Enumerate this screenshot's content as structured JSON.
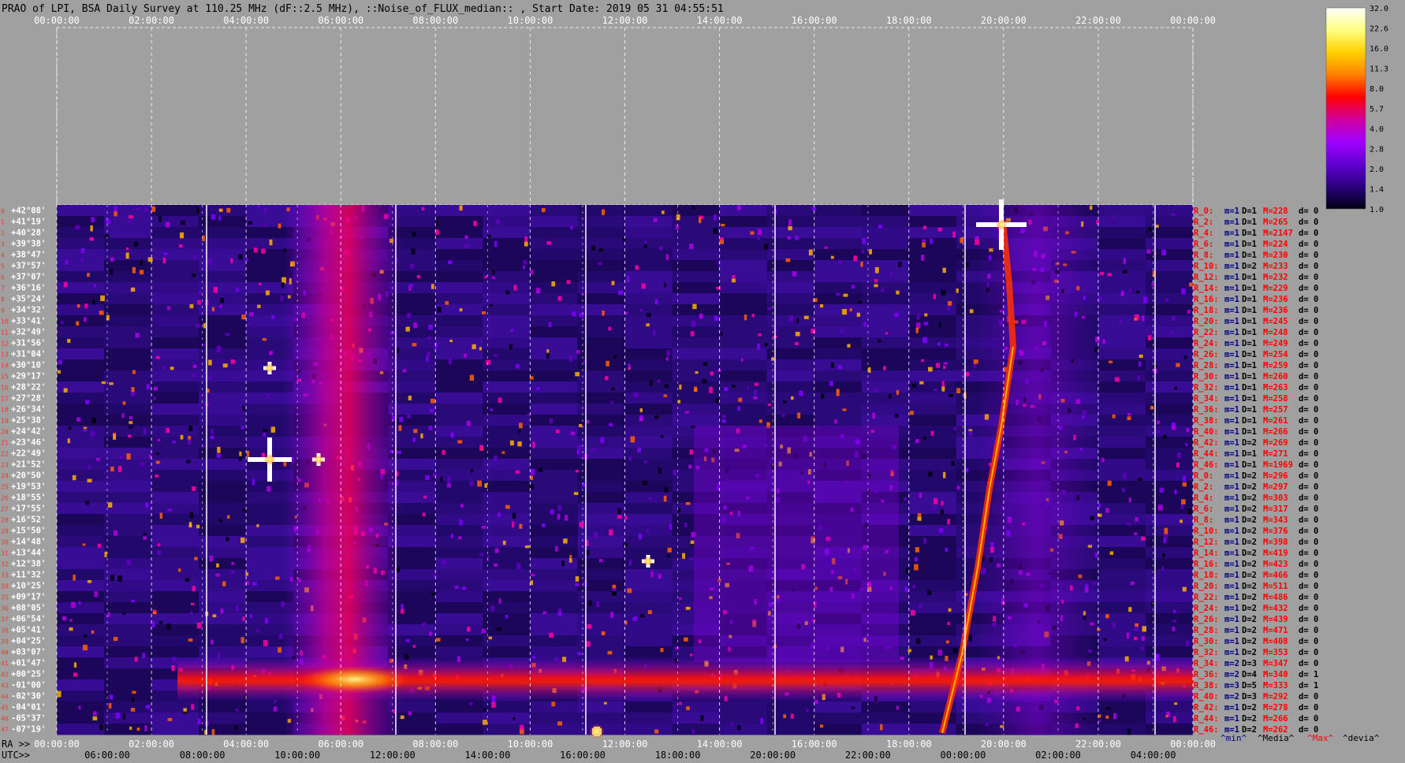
{
  "title": "PRAO of LPI, BSA Daily Survey at 110.25 MHz (dF::2.5 MHz), ::Noise_of_FLUX_median:: , Start Date: 2019 05 31 04:55:51",
  "axes": {
    "top_utc_ticks": [
      "00:00:00",
      "02:00:00",
      "04:00:00",
      "06:00:00",
      "08:00:00",
      "10:00:00",
      "12:00:00",
      "14:00:00",
      "16:00:00",
      "18:00:00",
      "20:00:00",
      "22:00:00",
      "00:00:00"
    ],
    "bottom_ra_label": "RA >>",
    "bottom_ra_ticks": [
      "00:00:00",
      "02:00:00",
      "04:00:00",
      "06:00:00",
      "08:00:00",
      "10:00:00",
      "12:00:00",
      "14:00:00",
      "16:00:00",
      "18:00:00",
      "20:00:00",
      "22:00:00",
      "00:00:00"
    ],
    "bottom_utc_label": "UTC>>",
    "bottom_utc_ticks": [
      "06:00:00",
      "08:00:00",
      "10:00:00",
      "12:00:00",
      "14:00:00",
      "16:00:00",
      "18:00:00",
      "20:00:00",
      "22:00:00",
      "00:00:00",
      "02:00:00",
      "04:00:00"
    ]
  },
  "colorbar": {
    "ticks": [
      "32.0",
      "22.6",
      "16.0",
      "11.3",
      "8.0",
      "5.7",
      "4.0",
      "2.8",
      "2.0",
      "1.4",
      "1.0"
    ],
    "stops": [
      "#ffffff",
      "#ffff80",
      "#ffd000",
      "#ff8000",
      "#ff0000",
      "#d000a0",
      "#a000ff",
      "#6000d0",
      "#2a0080",
      "#000010"
    ]
  },
  "stats_footer": [
    "^min^",
    "^Media^",
    "^Max^",
    "^devia^"
  ],
  "chart_data": {
    "type": "heatmap",
    "title": "PRAO of LPI, BSA Daily Survey at 110.25 MHz (dF::2.5 MHz), ::Noise_of_FLUX_median:: , Start Date: 2019 05 31 04:55:51",
    "x_axis": "UTC / RA, 24 h",
    "declinations": [
      "+42°08'",
      "+41°19'",
      "+40°28'",
      "+39°38'",
      "+38°47'",
      "+37°57'",
      "+37°07'",
      "+36°16'",
      "+35°24'",
      "+34°32'",
      "+33°41'",
      "+32°49'",
      "+31°56'",
      "+31°04'",
      "+30°10'",
      "+29°17'",
      "+28°22'",
      "+27°28'",
      "+26°34'",
      "+25°38'",
      "+24°42'",
      "+23°46'",
      "+22°49'",
      "+21°52'",
      "+20°50'",
      "+19°53'",
      "+18°55'",
      "+17°55'",
      "+16°52'",
      "+15°50'",
      "+14°48'",
      "+13°44'",
      "+12°38'",
      "+11°32'",
      "+10°25'",
      "+09°17'",
      "+08°05'",
      "+06°54'",
      "+05°41'",
      "+04°25'",
      "+03°07'",
      "+01°47'",
      "+00°25'",
      "-01°00'",
      "-02°30'",
      "-04°01'",
      "-05°37'",
      "-07°19'"
    ],
    "beam_indices": [
      "0",
      "1",
      "2",
      "3",
      "4",
      "5",
      "6",
      "7",
      "8",
      "9",
      "10",
      "11",
      "12",
      "13",
      "14",
      "15",
      "16",
      "17",
      "18",
      "19",
      "20",
      "21",
      "22",
      "23",
      "24",
      "25",
      "26",
      "27",
      "28",
      "29",
      "30",
      "31",
      "32",
      "33",
      "34",
      "35",
      "36",
      "37",
      "38",
      "39",
      "40",
      "41",
      "42",
      "43",
      "44",
      "45",
      "46",
      "47"
    ],
    "row_stats": [
      {
        "r": "R_0:",
        "m": "m=1",
        "d": "D=1",
        "M": "M=228",
        "dv": "d= 0"
      },
      {
        "r": "R_2:",
        "m": "m=1",
        "d": "D=1",
        "M": "M=265",
        "dv": "d= 0"
      },
      {
        "r": "R_4:",
        "m": "m=1",
        "d": "D=1",
        "M": "M=2147",
        "dv": "d= 0"
      },
      {
        "r": "R_6:",
        "m": "m=1",
        "d": "D=1",
        "M": "M=224",
        "dv": "d= 0"
      },
      {
        "r": "R_8:",
        "m": "m=1",
        "d": "D=1",
        "M": "M=230",
        "dv": "d= 0"
      },
      {
        "r": "R_10:",
        "m": "m=1",
        "d": "D=2",
        "M": "M=233",
        "dv": "d= 0"
      },
      {
        "r": "R_12:",
        "m": "m=1",
        "d": "D=1",
        "M": "M=232",
        "dv": "d= 0"
      },
      {
        "r": "R_14:",
        "m": "m=1",
        "d": "D=1",
        "M": "M=229",
        "dv": "d= 0"
      },
      {
        "r": "R_16:",
        "m": "m=1",
        "d": "D=1",
        "M": "M=236",
        "dv": "d= 0"
      },
      {
        "r": "R_18:",
        "m": "m=1",
        "d": "D=1",
        "M": "M=236",
        "dv": "d= 0"
      },
      {
        "r": "R_20:",
        "m": "m=1",
        "d": "D=1",
        "M": "M=245",
        "dv": "d= 0"
      },
      {
        "r": "R_22:",
        "m": "m=1",
        "d": "D=1",
        "M": "M=248",
        "dv": "d= 0"
      },
      {
        "r": "R_24:",
        "m": "m=1",
        "d": "D=1",
        "M": "M=249",
        "dv": "d= 0"
      },
      {
        "r": "R_26:",
        "m": "m=1",
        "d": "D=1",
        "M": "M=254",
        "dv": "d= 0"
      },
      {
        "r": "R_28:",
        "m": "m=1",
        "d": "D=1",
        "M": "M=259",
        "dv": "d= 0"
      },
      {
        "r": "R_30:",
        "m": "m=1",
        "d": "D=1",
        "M": "M=260",
        "dv": "d= 0"
      },
      {
        "r": "R_32:",
        "m": "m=1",
        "d": "D=1",
        "M": "M=263",
        "dv": "d= 0"
      },
      {
        "r": "R_34:",
        "m": "m=1",
        "d": "D=1",
        "M": "M=258",
        "dv": "d= 0"
      },
      {
        "r": "R_36:",
        "m": "m=1",
        "d": "D=1",
        "M": "M=257",
        "dv": "d= 0"
      },
      {
        "r": "R_38:",
        "m": "m=1",
        "d": "D=1",
        "M": "M=261",
        "dv": "d= 0"
      },
      {
        "r": "R_40:",
        "m": "m=1",
        "d": "D=1",
        "M": "M=266",
        "dv": "d= 0"
      },
      {
        "r": "R_42:",
        "m": "m=1",
        "d": "D=2",
        "M": "M=269",
        "dv": "d= 0"
      },
      {
        "r": "R_44:",
        "m": "m=1",
        "d": "D=1",
        "M": "M=271",
        "dv": "d= 0"
      },
      {
        "r": "R_46:",
        "m": "m=1",
        "d": "D=1",
        "M": "M=1969",
        "dv": "d= 0"
      },
      {
        "r": "R_0:",
        "m": "m=1",
        "d": "D=2",
        "M": "M=296",
        "dv": "d= 0"
      },
      {
        "r": "R_2:",
        "m": "m=1",
        "d": "D=2",
        "M": "M=297",
        "dv": "d= 0"
      },
      {
        "r": "R_4:",
        "m": "m=1",
        "d": "D=2",
        "M": "M=303",
        "dv": "d= 0"
      },
      {
        "r": "R_6:",
        "m": "m=1",
        "d": "D=2",
        "M": "M=317",
        "dv": "d= 0"
      },
      {
        "r": "R_8:",
        "m": "m=1",
        "d": "D=2",
        "M": "M=343",
        "dv": "d= 0"
      },
      {
        "r": "R_10:",
        "m": "m=1",
        "d": "D=2",
        "M": "M=376",
        "dv": "d= 0"
      },
      {
        "r": "R_12:",
        "m": "m=1",
        "d": "D=2",
        "M": "M=398",
        "dv": "d= 0"
      },
      {
        "r": "R_14:",
        "m": "m=1",
        "d": "D=2",
        "M": "M=419",
        "dv": "d= 0"
      },
      {
        "r": "R_16:",
        "m": "m=1",
        "d": "D=2",
        "M": "M=423",
        "dv": "d= 0"
      },
      {
        "r": "R_18:",
        "m": "m=1",
        "d": "D=2",
        "M": "M=466",
        "dv": "d= 0"
      },
      {
        "r": "R_20:",
        "m": "m=1",
        "d": "D=2",
        "M": "M=511",
        "dv": "d= 0"
      },
      {
        "r": "R_22:",
        "m": "m=1",
        "d": "D=2",
        "M": "M=486",
        "dv": "d= 0"
      },
      {
        "r": "R_24:",
        "m": "m=1",
        "d": "D=2",
        "M": "M=432",
        "dv": "d= 0"
      },
      {
        "r": "R_26:",
        "m": "m=1",
        "d": "D=2",
        "M": "M=439",
        "dv": "d= 0"
      },
      {
        "r": "R_28:",
        "m": "m=1",
        "d": "D=2",
        "M": "M=471",
        "dv": "d= 0"
      },
      {
        "r": "R_30:",
        "m": "m=1",
        "d": "D=2",
        "M": "M=408",
        "dv": "d= 0"
      },
      {
        "r": "R_32:",
        "m": "m=1",
        "d": "D=2",
        "M": "M=353",
        "dv": "d= 0"
      },
      {
        "r": "R_34:",
        "m": "m=2",
        "d": "D=3",
        "M": "M=347",
        "dv": "d= 0"
      },
      {
        "r": "R_36:",
        "m": "m=2",
        "d": "D=4",
        "M": "M=340",
        "dv": "d= 1"
      },
      {
        "r": "R_38:",
        "m": "m=3",
        "d": "D=5",
        "M": "M=333",
        "dv": "d= 1"
      },
      {
        "r": "R_40:",
        "m": "m=2",
        "d": "D=3",
        "M": "M=292",
        "dv": "d= 0"
      },
      {
        "r": "R_42:",
        "m": "m=1",
        "d": "D=2",
        "M": "M=278",
        "dv": "d= 0"
      },
      {
        "r": "R_44:",
        "m": "m=1",
        "d": "D=2",
        "M": "M=266",
        "dv": "d= 0"
      },
      {
        "r": "R_46:",
        "m": "m=1",
        "d": "D=2",
        "M": "M=262",
        "dv": "d= 0"
      }
    ]
  }
}
